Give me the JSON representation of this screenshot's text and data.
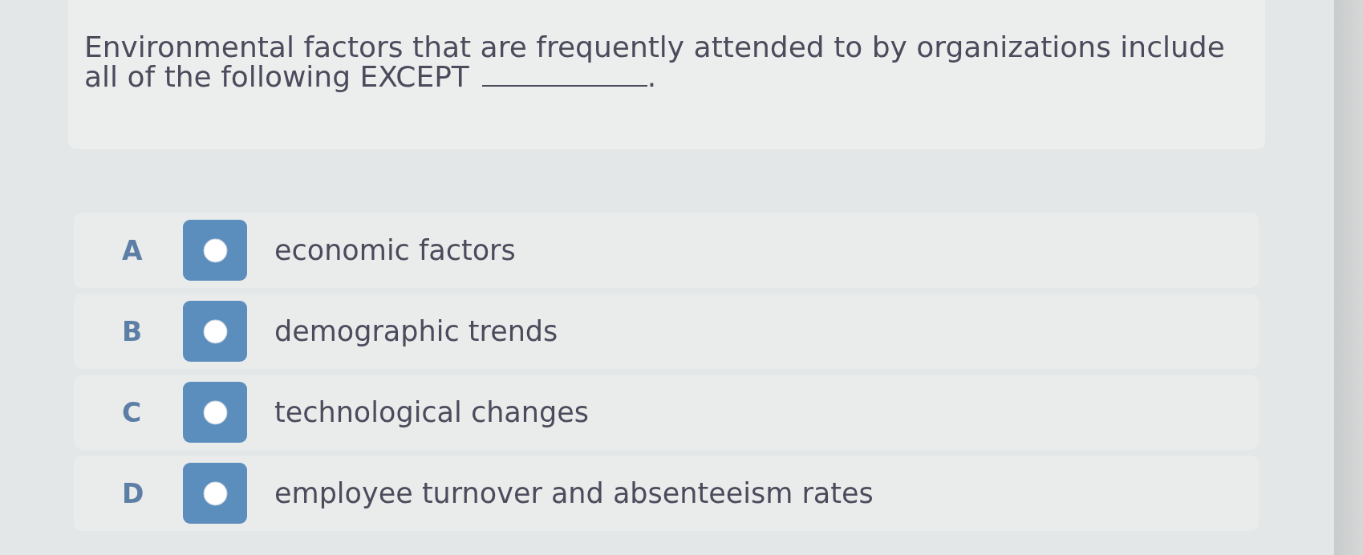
{
  "question": {
    "text_before": "Environmental factors that are frequently attended to by organizations include all of the following EXCEPT",
    "text_after": "."
  },
  "options": [
    {
      "letter": "A",
      "text": "economic factors",
      "selected": false
    },
    {
      "letter": "B",
      "text": "demographic trends",
      "selected": false
    },
    {
      "letter": "C",
      "text": "technological changes",
      "selected": false
    },
    {
      "letter": "D",
      "text": "employee turnover and absenteeism rates",
      "selected": false
    }
  ]
}
